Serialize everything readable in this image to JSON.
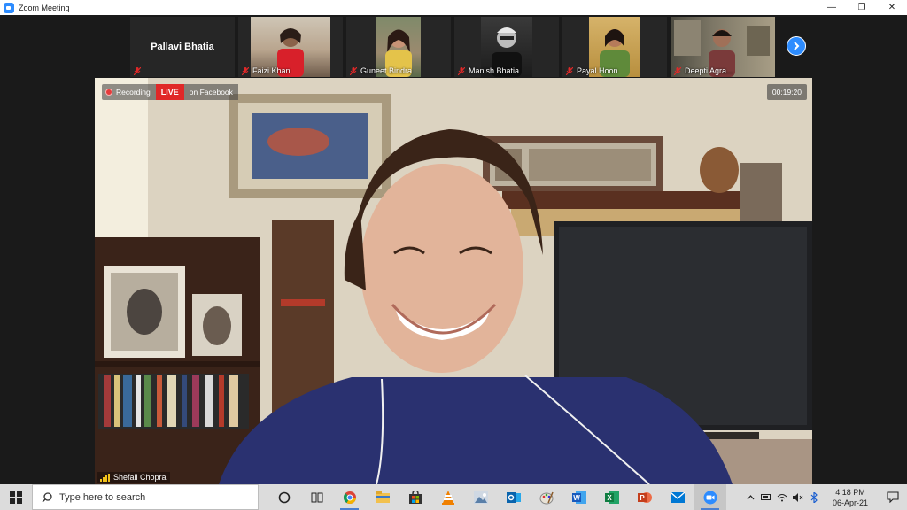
{
  "window": {
    "title": "Zoom Meeting"
  },
  "gallery": {
    "name_only": {
      "name": "Pallavi Bhatia"
    },
    "participants": [
      {
        "name": "Faizi Khan"
      },
      {
        "name": "Guneet Bindra"
      },
      {
        "name": "Manish Bhatia"
      },
      {
        "name": "Payal Hoon"
      },
      {
        "name": "Deepti Agra..."
      }
    ]
  },
  "main": {
    "recording_label": "Recording",
    "live_label": "LIVE",
    "stream_label": "on Facebook",
    "timer": "00:19:20",
    "speaker_name": "Shefali Chopra"
  },
  "taskbar": {
    "search_placeholder": "Type here to search",
    "apps": [
      "cortana-icon",
      "task-view-icon",
      "chrome-icon",
      "file-explorer-icon",
      "store-icon",
      "vlc-icon",
      "photos-icon",
      "outlook-icon",
      "paint-icon",
      "word-icon",
      "excel-icon",
      "powerpoint-icon",
      "mail-icon",
      "zoom-icon"
    ],
    "time": "4:18 PM",
    "date": "06-Apr-21"
  },
  "colors": {
    "zoom_blue": "#2d8cff",
    "live_red": "#e02828",
    "taskbar": "#dcdcdc"
  }
}
